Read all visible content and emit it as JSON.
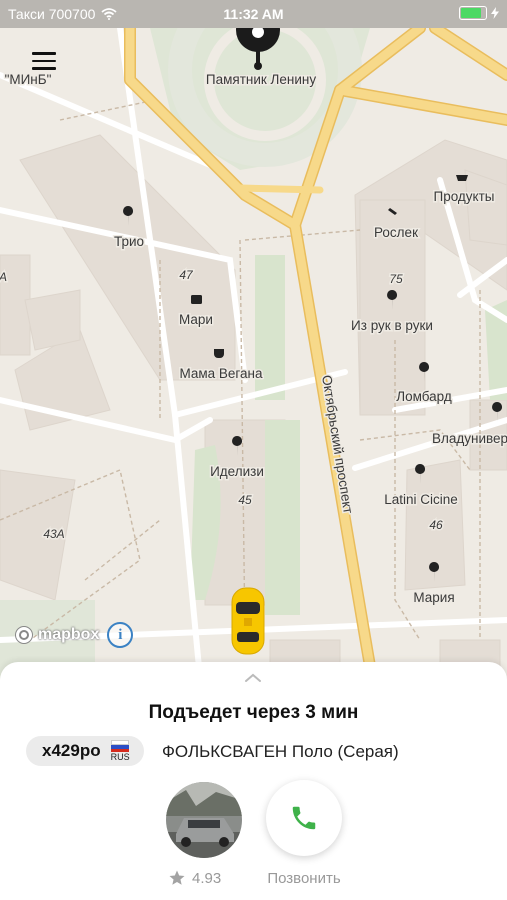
{
  "status": {
    "carrier": "Такси 700700",
    "time": "11:32 AM"
  },
  "map": {
    "labels": {
      "lenin": "Памятник Ленину",
      "minb": "\"МИнБ\"",
      "produkty": "Продукты",
      "roslek": "Рослек",
      "trio": "Трио",
      "n47": "47",
      "mari": "Мари",
      "mama": "Мама Вегана",
      "n75": "75",
      "izruk": "Из рук в руки",
      "lombard": "Ломбард",
      "vladun": "Владунивер",
      "idelizi": "Иделизи",
      "n45": "45",
      "prospekt": "Октябрьский проспект",
      "latini": "Latini Cicine",
      "n46": "46",
      "n43a": "43А",
      "maria": "Мария",
      "a": "А"
    },
    "attribution": "mapbox",
    "info_symbol": "i"
  },
  "sheet": {
    "eta": "Подъедет через 3 мин",
    "plate": "х429ро",
    "plate_country": "RUS",
    "car": "ФОЛЬКСВАГЕН Поло (Серая)",
    "rating": "4.93",
    "call_label": "Позвонить"
  },
  "colors": {
    "road_major": "#f6d27b",
    "road_major_edge": "#e9bd5d",
    "taxi": "#f7c600",
    "call_green": "#3fb24a",
    "map_bg": "#efebe4",
    "park": "#d8e4cd"
  }
}
